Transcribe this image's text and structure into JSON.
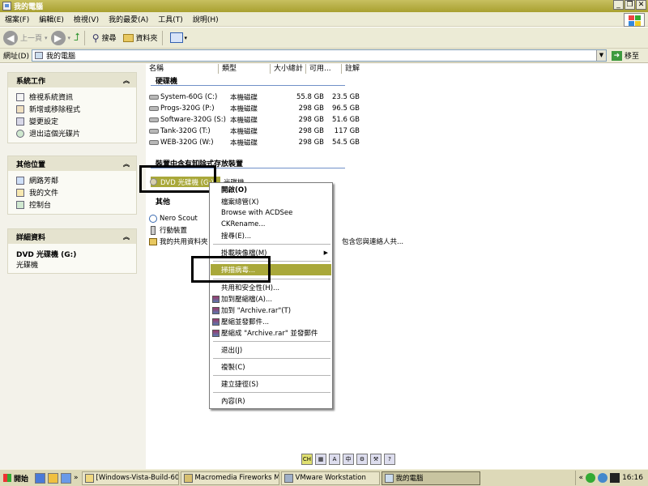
{
  "window": {
    "title": "我的電腦"
  },
  "menubar": [
    "檔案(F)",
    "編輯(E)",
    "檢視(V)",
    "我的最愛(A)",
    "工具(T)",
    "說明(H)"
  ],
  "toolbar": {
    "back": "上一頁",
    "search": "搜尋",
    "folders": "資料夾"
  },
  "address": {
    "label": "網址(D)",
    "value": "我的電腦",
    "go": "移至"
  },
  "left": {
    "system_tasks": {
      "title": "系統工作",
      "items": [
        "檢視系統資訊",
        "新增或移除程式",
        "變更設定",
        "退出這個光碟片"
      ]
    },
    "other_places": {
      "title": "其他位置",
      "items": [
        "網路芳鄰",
        "我的文件",
        "控制台"
      ]
    },
    "details": {
      "title": "詳細資料",
      "name": "DVD 光碟機 (G:)",
      "type": "光碟機"
    }
  },
  "columns": [
    "名稱",
    "類型",
    "大小總計",
    "可用...",
    "註解"
  ],
  "groups": {
    "hdd": "硬碟機",
    "removable": "裝置中含有卸除式存放裝置",
    "other": "其他"
  },
  "drives": [
    {
      "name": "System-60G (C:)",
      "type": "本機磁碟",
      "total": "55.8 GB",
      "free": "23.5 GB"
    },
    {
      "name": "Progs-320G (P:)",
      "type": "本機磁碟",
      "total": "298 GB",
      "free": "96.5 GB"
    },
    {
      "name": "Software-320G (S:)",
      "type": "本機磁碟",
      "total": "298 GB",
      "free": "51.6 GB"
    },
    {
      "name": "Tank-320G (T:)",
      "type": "本機磁碟",
      "total": "298 GB",
      "free": "117 GB"
    },
    {
      "name": "WEB-320G (W:)",
      "type": "本機磁碟",
      "total": "298 GB",
      "free": "54.5 GB"
    }
  ],
  "dvd": {
    "name": "DVD 光碟機 (G:)",
    "type": "光碟機"
  },
  "others": [
    {
      "name": "Nero Scout"
    },
    {
      "name": "行動裝置"
    },
    {
      "name": "我的共用資料夾",
      "comment": "包含您與連絡人共..."
    }
  ],
  "context_menu": {
    "open": "開啟(O)",
    "explore": "檔案總管(X)",
    "acdsee": "Browse with ACDSee",
    "ckrename": "CKRename...",
    "search": "搜尋(E)...",
    "autoplay": "掛載映像檔(M)",
    "scan": "掃描病毒...",
    "share": "共用和安全性(H)...",
    "add_archive": "加到壓縮檔(A)...",
    "add_rar": "加到 \"Archive.rar\"(T)",
    "compress_email": "壓縮並發郵件...",
    "compress_rar_email": "壓縮成 \"Archive.rar\" 並發郵件",
    "eject": "退出(J)",
    "copy": "複製(C)",
    "shortcut": "建立捷徑(S)",
    "properties": "內容(R)"
  },
  "taskbar": {
    "start": "開始",
    "tasks": [
      "[Windows-Vista-Build-60...",
      "Macromedia Fireworks M...",
      "VMware Workstation",
      "我的電腦"
    ],
    "clock": "16:16"
  },
  "colors": {
    "highlight": "#a9a83a",
    "titlebar": "#b8b048"
  }
}
